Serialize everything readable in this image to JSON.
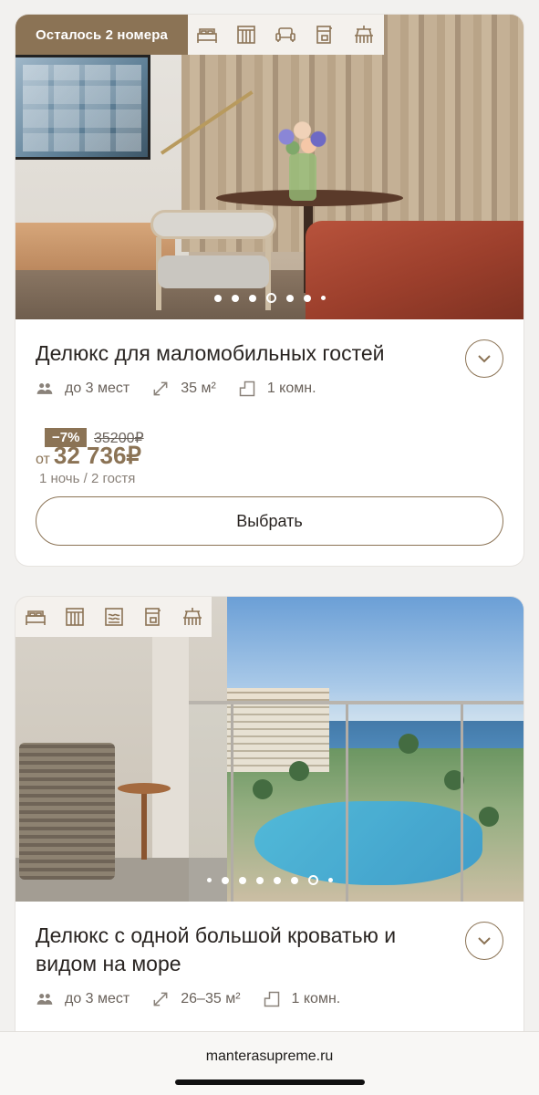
{
  "cards": [
    {
      "badge": "Осталось 2 номера",
      "amenity_icons": [
        "bed-icon",
        "wardrobe-icon",
        "armchair-icon",
        "coffee-machine-icon",
        "balcony-icon"
      ],
      "photo_dots": {
        "count": 7,
        "active_index": 3
      },
      "title": "Делюкс для маломобильных гостей",
      "guests": "до 3 мест",
      "area": "35 м²",
      "rooms": "1 комн.",
      "discount": "−7%",
      "old_price": "35200₽",
      "price_prefix": "от",
      "price": "32 736₽",
      "price_note": "1 ночь / 2 гостя",
      "select_button": "Выбрать"
    },
    {
      "amenity_icons": [
        "bed-icon",
        "wardrobe-icon",
        "sea-view-icon",
        "coffee-machine-icon",
        "balcony-icon"
      ],
      "photo_dots": {
        "count": 8,
        "active_index": 6
      },
      "title": "Делюкс с одной большой кроватью и видом на море",
      "guests": "до 3 мест",
      "area": "26–35 м²",
      "rooms": "1 комн."
    }
  ],
  "browser": {
    "url": "manterasupreme.ru"
  },
  "colors": {
    "accent": "#8b7355",
    "text": "#2a2522",
    "muted": "#6a625b",
    "background": "#f2f1ef"
  }
}
